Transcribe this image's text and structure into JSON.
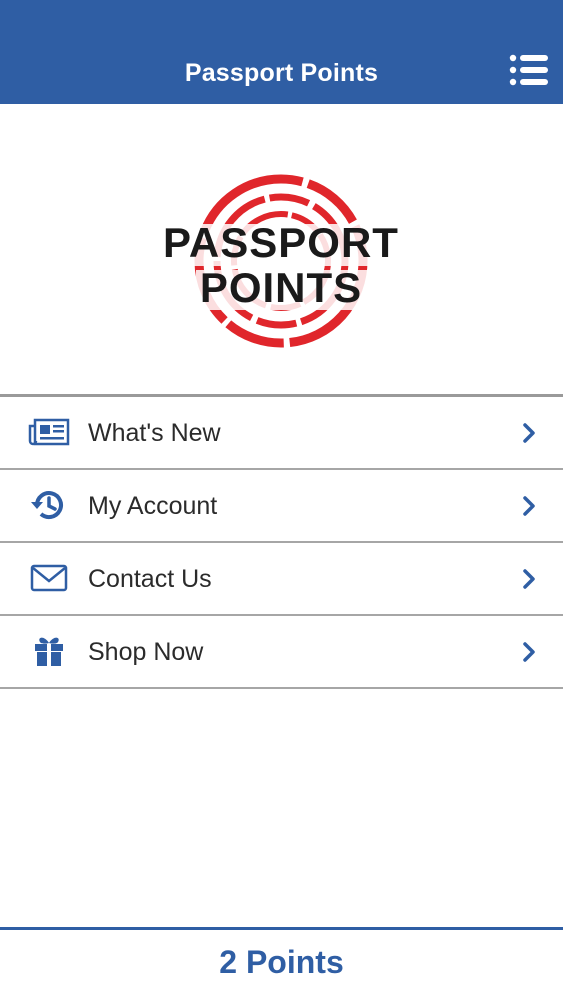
{
  "header": {
    "title": "Passport Points",
    "menu_icon": "list-menu-icon"
  },
  "logo": {
    "line1": "PASSPORT",
    "line2": "POINTS",
    "stamp_color": "#e0262b"
  },
  "menu": {
    "items": [
      {
        "label": "What's New",
        "icon": "newspaper-icon"
      },
      {
        "label": "My Account",
        "icon": "history-icon"
      },
      {
        "label": "Contact Us",
        "icon": "envelope-icon"
      },
      {
        "label": "Shop Now",
        "icon": "gift-icon"
      }
    ]
  },
  "footer": {
    "points_text": "2 Points"
  },
  "colors": {
    "brand_blue": "#2f5ea4",
    "divider": "#a6a6a6"
  }
}
